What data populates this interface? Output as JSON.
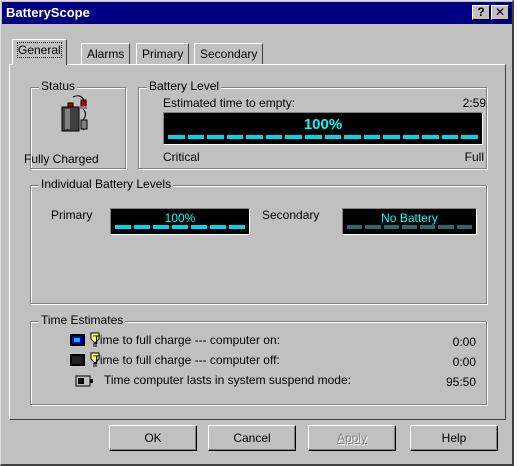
{
  "window": {
    "title": "BatteryScope",
    "help_glyph": "?",
    "close_glyph": "✕"
  },
  "tabs": [
    {
      "label": "General",
      "active": true
    },
    {
      "label": "Alarms",
      "active": false
    },
    {
      "label": "Primary",
      "active": false
    },
    {
      "label": "Secondary",
      "active": false
    }
  ],
  "status": {
    "group_label": "Status",
    "state": "Fully Charged",
    "icon": "battery-plug-icon"
  },
  "battery_level": {
    "group_label": "Battery Level",
    "estimate_label": "Estimated time to empty:",
    "estimate_value": "2:59",
    "percent_text": "100%",
    "percent": 100,
    "critical_label": "Critical",
    "full_label": "Full"
  },
  "individual": {
    "group_label": "Individual Battery Levels",
    "primary": {
      "label": "Primary",
      "value": "100%",
      "percent": 100
    },
    "secondary": {
      "label": "Secondary",
      "value": "No Battery",
      "percent": 0
    }
  },
  "time_estimates": {
    "group_label": "Time Estimates",
    "rows": [
      {
        "label": "Time to full charge --- computer on:",
        "value": "0:00",
        "icon": "computer-on-charge-icon"
      },
      {
        "label": "Time to full charge --- computer off:",
        "value": "0:00",
        "icon": "computer-off-charge-icon"
      },
      {
        "label": "Time computer lasts in system suspend mode:",
        "value": "95:50",
        "icon": "suspend-mode-icon"
      }
    ]
  },
  "buttons": {
    "ok": "OK",
    "cancel": "Cancel",
    "apply": "Apply",
    "help": "Help"
  },
  "colors": {
    "titlebar": "#000080",
    "dialog": "#c0c0c0",
    "lcd_text": "#00ffff",
    "lcd_segment_on": "#00d8e8",
    "lcd_segment_off": "#2a6a6a"
  }
}
